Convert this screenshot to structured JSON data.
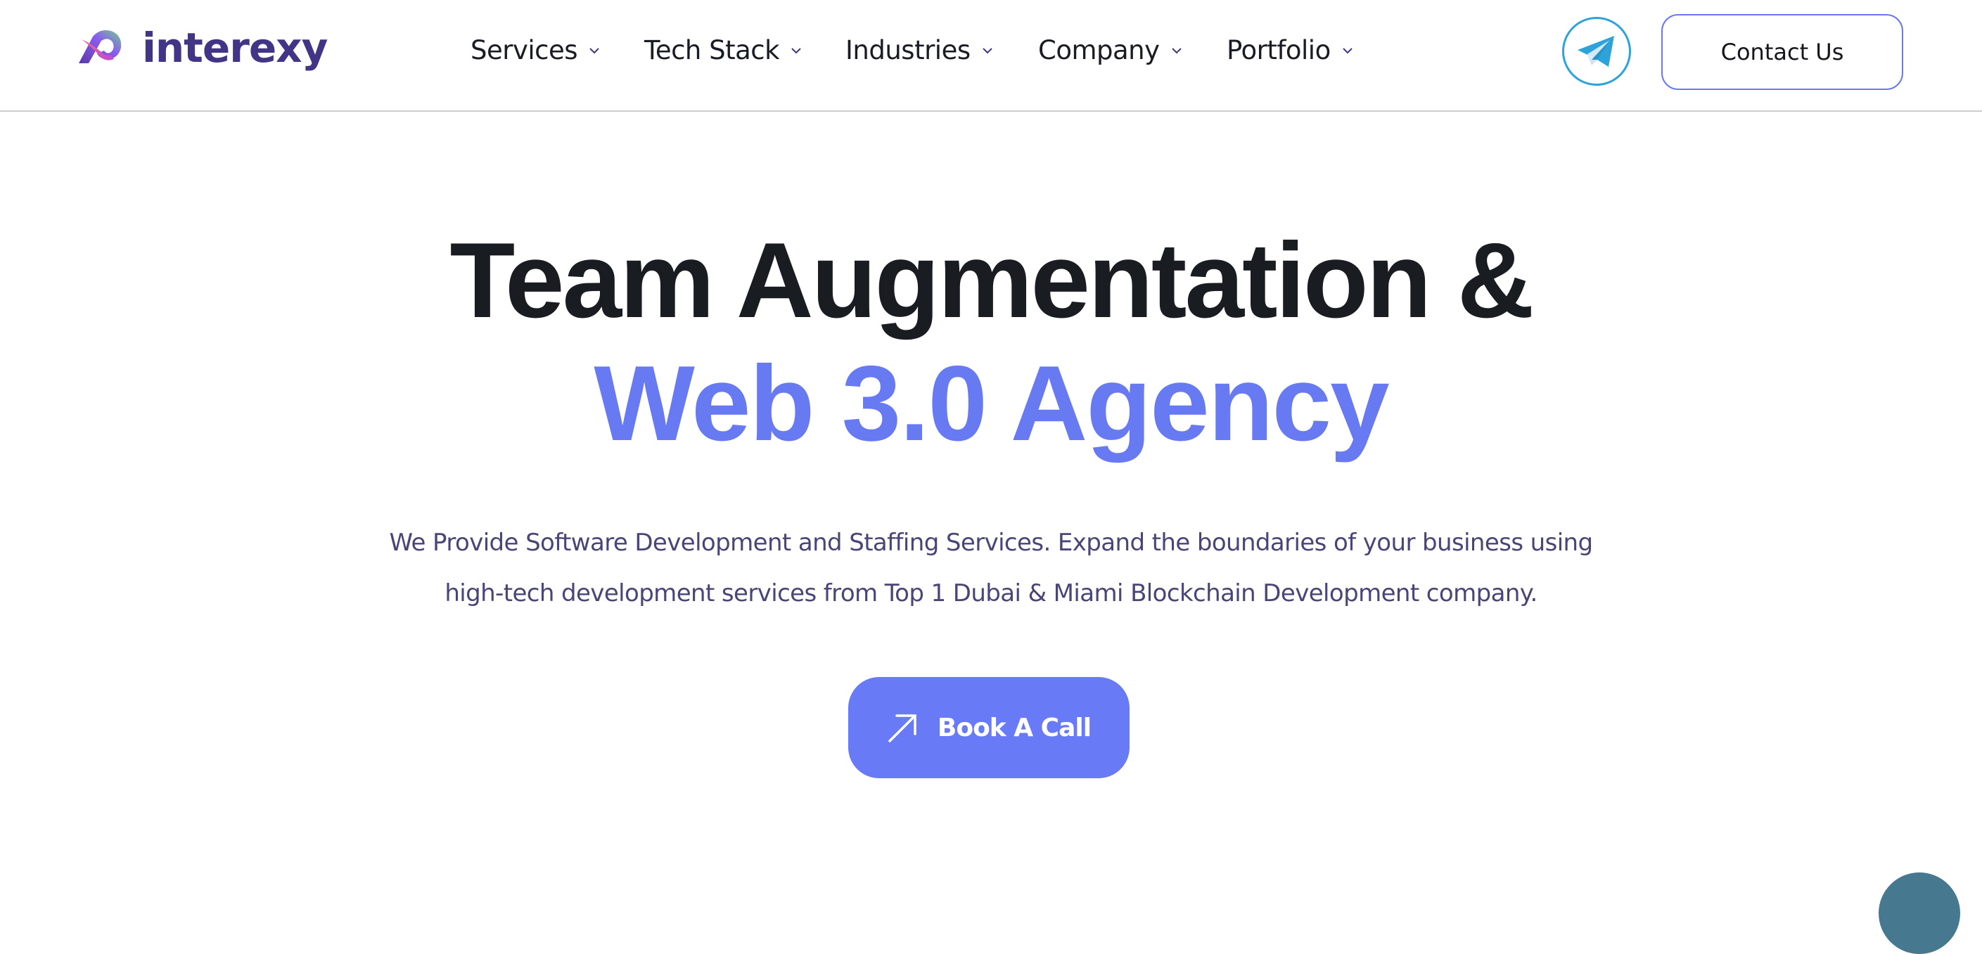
{
  "header": {
    "logo_text": "interexy",
    "nav": [
      {
        "label": "Services"
      },
      {
        "label": "Tech Stack"
      },
      {
        "label": "Industries"
      },
      {
        "label": "Company"
      },
      {
        "label": "Portfolio"
      }
    ],
    "telegram_icon": "telegram-icon",
    "contact_label": "Contact Us"
  },
  "hero": {
    "title_line1": "Team Augmentation &",
    "title_line2": "Web 3.0 Agency",
    "description_line1": "We Provide Software Development and Staffing Services. Expand the boundaries of your business using",
    "description_line2": "high-tech development services from Top 1 Dubai & Miami Blockchain Development company.",
    "cta_label": "Book A Call",
    "cta_icon": "arrow-up-right-icon"
  },
  "colors": {
    "brand": "#433585",
    "accent": "#687af2",
    "heading": "#191c20",
    "body_text": "#4a4577",
    "telegram": "#2ea3d9",
    "fab": "#46788f"
  }
}
